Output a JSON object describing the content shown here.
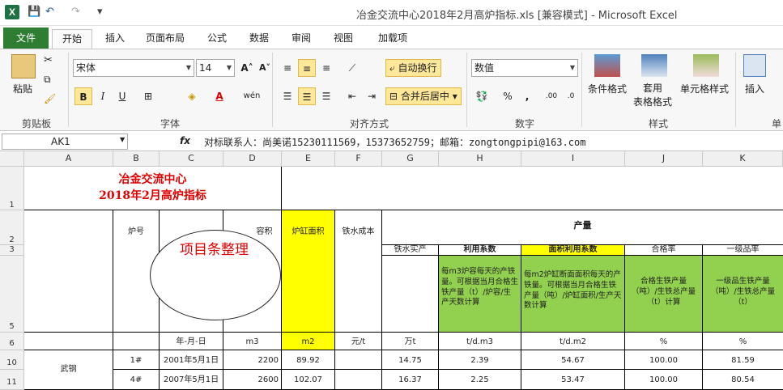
{
  "window": {
    "title": "冶金交流中心2018年2月高炉指标.xls  [兼容模式]  -  Microsoft Excel",
    "logo": "X"
  },
  "quick_access": {
    "save": "💾",
    "undo": "↶",
    "redo": "↷",
    "customize": "▾"
  },
  "tabs": [
    "文件",
    "开始",
    "插入",
    "页面布局",
    "公式",
    "数据",
    "审阅",
    "视图",
    "加载项"
  ],
  "ribbon": {
    "clipboard": {
      "paste": "粘贴",
      "label": "剪贴板"
    },
    "font": {
      "name": "宋体",
      "size": "14",
      "bold": "B",
      "italic": "I",
      "underline": "U",
      "grow": "A",
      "shrink": "A",
      "font_color": "A",
      "label": "字体"
    },
    "alignment": {
      "wrap": "自动换行",
      "merge": "合并后居中",
      "label": "对齐方式"
    },
    "number": {
      "format": "数值",
      "percent": "%",
      "comma": ",",
      "label": "数字"
    },
    "styles": {
      "cond": "条件格式",
      "table": "套用\n表格格式",
      "cell": "单元格样式",
      "label": "样式"
    },
    "cells": {
      "insert": "插入",
      "label": "单"
    }
  },
  "formula_bar": {
    "name_box": "AK1",
    "fx": "fx",
    "content": "对标联系人：尚美诺15230111569，15373652759；邮箱：zongtongpipi@163.com"
  },
  "columns": [
    "A",
    "B",
    "C",
    "D",
    "E",
    "F",
    "G",
    "H",
    "I",
    "J",
    "K"
  ],
  "rows": [
    "1",
    "2",
    "3",
    "5",
    "6",
    "10",
    "11"
  ],
  "sheet": {
    "title1": "冶金交流中心",
    "title2": "2018年2月高炉指标",
    "h_furnace": "炉号",
    "h_volume": "容积",
    "h_area": "炉缸面积",
    "h_cost": "铁水成本",
    "h_output": "产量",
    "h_real": "铁水实产",
    "h_util": "利用系数",
    "h_area_util": "面积利用系数",
    "h_pass": "合格率",
    "h_first": "一级品率",
    "d_util": "每m3炉容每天的产铁量。可根据当月合格生铁产量（t）/炉容/生产天数计算",
    "d_area_util": "每m2炉缸断面面积每天的产铁量。可根据当月合格生铁产量（吨）/炉缸面积/生产天数计算",
    "d_pass": "合格生铁产量（吨）/生铁总产量（t）计算",
    "d_first": "一级品生铁产量（吨）/生铁总产量（t）",
    "units": [
      "",
      "",
      "年-月-日",
      "m3",
      "m2",
      "元/t",
      "万t",
      "t/d.m3",
      "t/d.m2",
      "%",
      "%"
    ],
    "company": "武钢",
    "data": [
      {
        "no": "1#",
        "date": "2001年5月1日",
        "vol": "2200",
        "area": "89.92",
        "cost": "",
        "real": "14.75",
        "util": "2.39",
        "area_util": "54.67",
        "pass": "100.00",
        "first": "81.59"
      },
      {
        "no": "4#",
        "date": "2007年5月1日",
        "vol": "2600",
        "area": "102.07",
        "cost": "",
        "real": "16.37",
        "util": "2.25",
        "area_util": "53.47",
        "pass": "100.00",
        "first": "80.54"
      }
    ]
  },
  "callout": {
    "text": "项目条整理"
  }
}
